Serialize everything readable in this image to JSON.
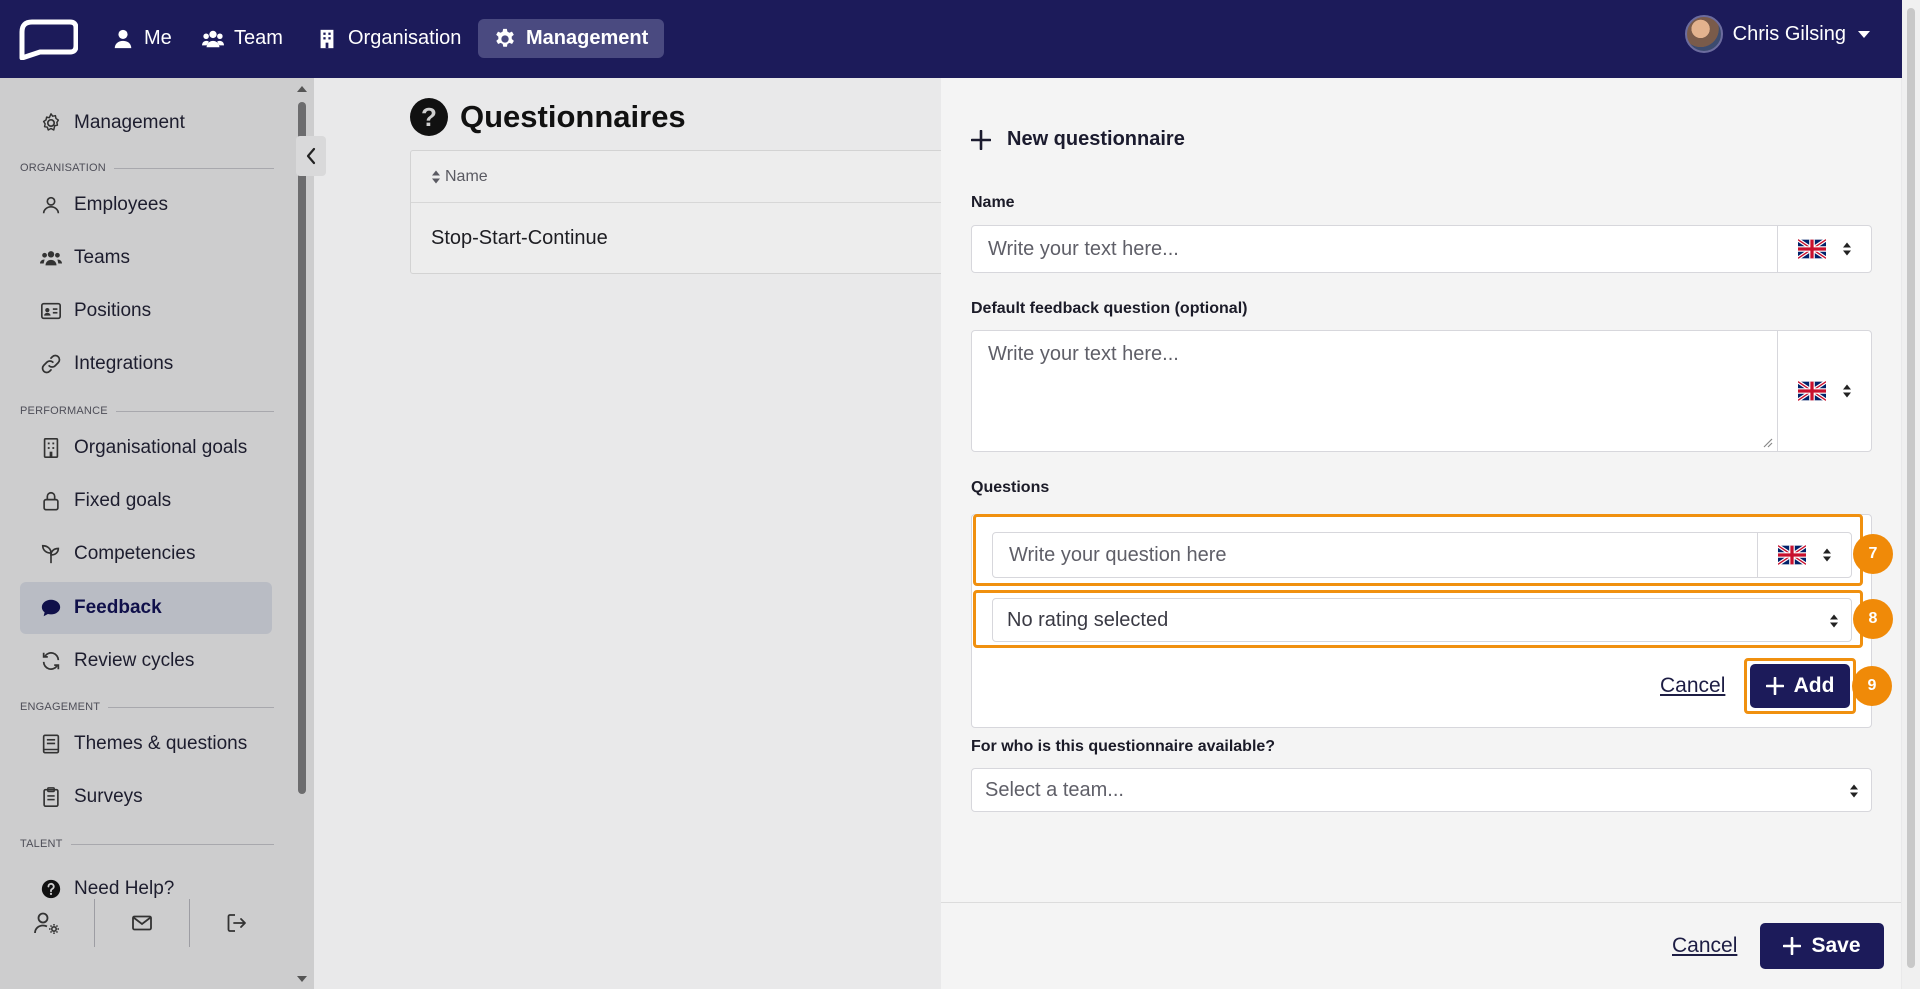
{
  "topnav": {
    "items": [
      {
        "label": "Me",
        "icon": "person-icon"
      },
      {
        "label": "Team",
        "icon": "people-icon"
      },
      {
        "label": "Organisation",
        "icon": "building-icon"
      },
      {
        "label": "Management",
        "icon": "gear-icon",
        "active": true
      }
    ],
    "user_name": "Chris Gilsing"
  },
  "sidebar": {
    "top_item": "Management",
    "sections": {
      "organisation": "ORGANISATION",
      "performance": "PERFORMANCE",
      "engagement": "ENGAGEMENT",
      "talent": "TALENT"
    },
    "items": {
      "employees": "Employees",
      "teams": "Teams",
      "positions": "Positions",
      "integrations": "Integrations",
      "org_goals": "Organisational goals",
      "fixed_goals": "Fixed goals",
      "competencies": "Competencies",
      "feedback": "Feedback",
      "review_cycles": "Review cycles",
      "themes": "Themes & questions",
      "surveys": "Surveys",
      "help": "Need Help?"
    }
  },
  "main": {
    "title": "Questionnaires",
    "table_header": "Name",
    "rows": [
      "Stop-Start-Continue"
    ]
  },
  "panel": {
    "title": "New questionnaire",
    "name_label": "Name",
    "name_placeholder": "Write your text here...",
    "default_q_label": "Default feedback question (optional)",
    "default_q_placeholder": "Write your text here...",
    "questions_label": "Questions",
    "question_placeholder": "Write your question here",
    "rating_value": "No rating selected",
    "cancel": "Cancel",
    "add": "Add",
    "availability_label": "For who is this questionnaire available?",
    "team_placeholder": "Select a team...",
    "footer_cancel": "Cancel",
    "save": "Save"
  },
  "annotations": {
    "step7": "7",
    "step8": "8",
    "step9": "9"
  },
  "colors": {
    "brand": "#1c1b5a",
    "highlight": "#f08a08"
  }
}
